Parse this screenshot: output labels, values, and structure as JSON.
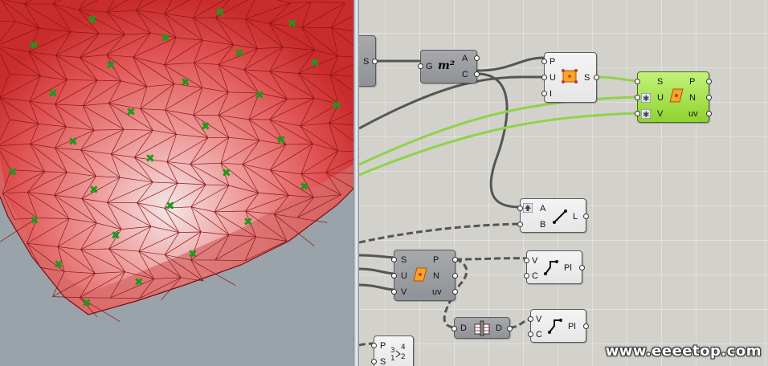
{
  "colors": {
    "surface": "#e23b3b",
    "mesh": "#8d1414",
    "points": "#1a9a1a",
    "wire_dark": "#555555",
    "wire_green": "#8fd34a",
    "node_green": "#9ddc3f"
  },
  "components": {
    "partial_left": {
      "out": "S"
    },
    "area": {
      "in": "G",
      "out_a": "A",
      "out_c": "C",
      "icon": "area-m2-icon"
    },
    "surface_closest": {
      "in_p": "P",
      "in_u": "U",
      "in_i": "I",
      "out": "S"
    },
    "evaluate_green": {
      "in_s": "S",
      "in_u": "U",
      "in_v": "V",
      "out_p": "P",
      "out_n": "N",
      "out_uv": "uv"
    },
    "line": {
      "in_a": "A",
      "in_b": "B",
      "out": "L"
    },
    "evaluate_dark": {
      "in_s": "S",
      "in_u": "U",
      "in_v": "V",
      "out_p": "P",
      "out_n": "N",
      "out_uv": "uv"
    },
    "plane_top": {
      "in_v": "V",
      "in_c": "C",
      "out": "Pl"
    },
    "plane_bottom": {
      "in_v": "V",
      "in_c": "C",
      "out": "Pl"
    },
    "data_dam": {
      "in": "D",
      "out": "D"
    },
    "sort_partial": {
      "in_p": "P",
      "in_s": "S"
    }
  },
  "watermark": "www.eeeetop.com"
}
